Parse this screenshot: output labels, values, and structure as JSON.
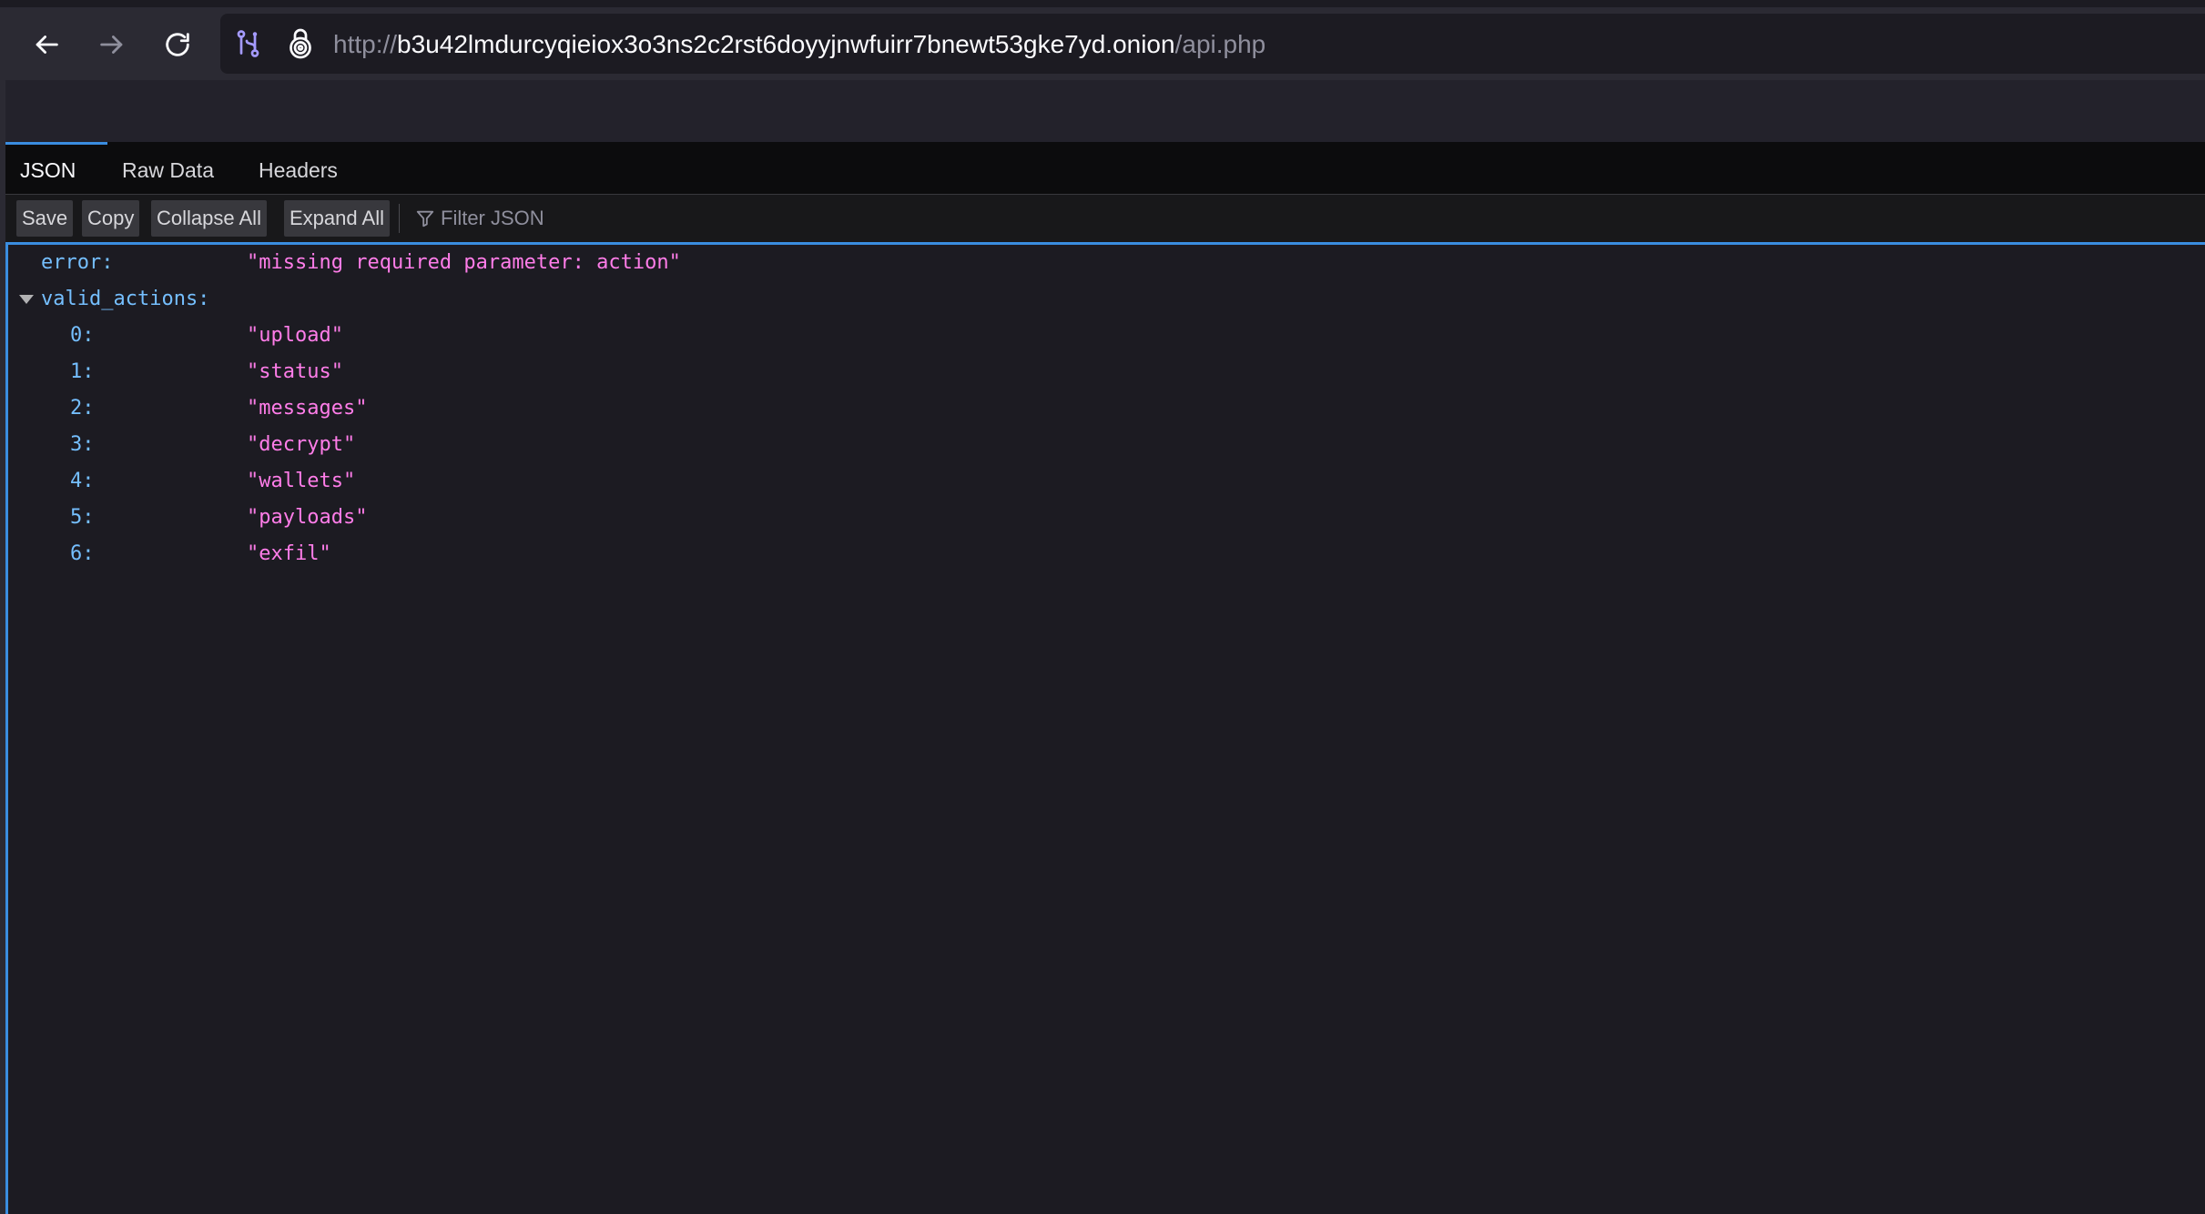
{
  "browser": {
    "back_icon": "arrow-left-icon",
    "forward_icon": "arrow-right-icon",
    "reload_icon": "reload-icon",
    "url_scheme": "http://",
    "url_host": "b3u42lmdurcyqieiox3o3ns2c2rst6doyyjnwfuirr7bnewt53gke7yd.onion",
    "url_path": "/api.php"
  },
  "tabs": [
    {
      "label": "JSON",
      "selected": true
    },
    {
      "label": "Raw Data",
      "selected": false
    },
    {
      "label": "Headers",
      "selected": false
    }
  ],
  "actions": {
    "save": "Save",
    "copy": "Copy",
    "collapse_all": "Collapse All",
    "expand_all": "Expand All",
    "filter_placeholder": "Filter JSON"
  },
  "json": {
    "error_key": "error:",
    "error_value": "\"missing required parameter: action\"",
    "valid_actions_key": "valid_actions:",
    "valid_actions": [
      {
        "index": "0:",
        "value": "\"upload\""
      },
      {
        "index": "1:",
        "value": "\"status\""
      },
      {
        "index": "2:",
        "value": "\"messages\""
      },
      {
        "index": "3:",
        "value": "\"decrypt\""
      },
      {
        "index": "4:",
        "value": "\"wallets\""
      },
      {
        "index": "5:",
        "value": "\"payloads\""
      },
      {
        "index": "6:",
        "value": "\"exfil\""
      }
    ]
  },
  "colors": {
    "accent": "#3a8de0",
    "key": "#75bfff",
    "string": "#ff7de9",
    "background": "#1c1b22"
  }
}
